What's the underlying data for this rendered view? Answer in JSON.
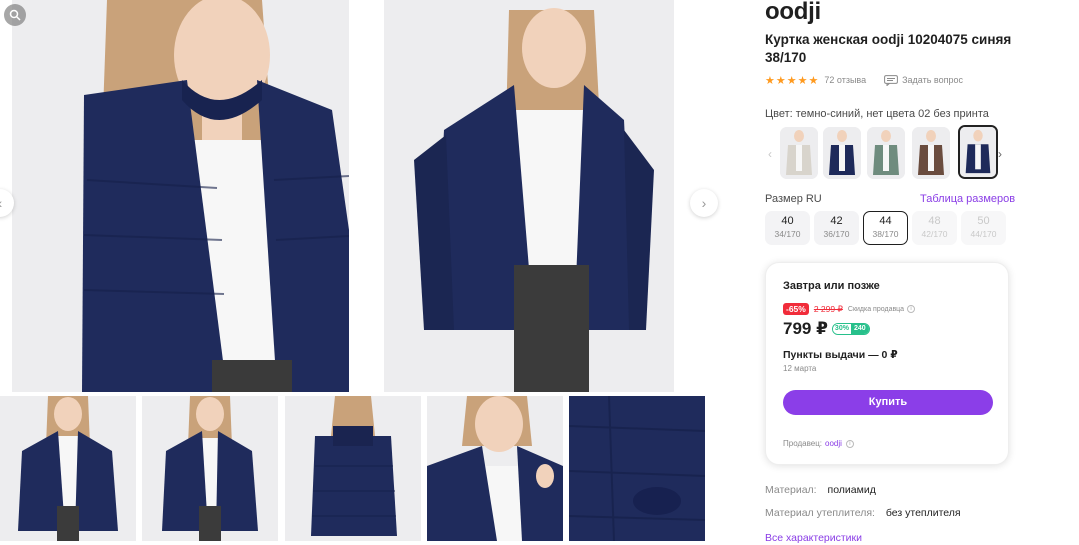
{
  "product": {
    "brand": "oodji",
    "title": "Куртка женская oodji 10204075 синяя 38/170",
    "rating": 5,
    "reviews": "72 отзыва",
    "ask_question": "Задать вопрос"
  },
  "gallery": {
    "icons": {
      "zoom": "search-icon",
      "prev": "chevron-left-icon",
      "next": "chevron-right-icon"
    }
  },
  "color": {
    "label": "Цвет: темно-синий, нет цвета 02 без принта",
    "swatches": [
      {
        "color": "#d8d4cc"
      },
      {
        "color": "#1e2a5a"
      },
      {
        "color": "#6f8c7e"
      },
      {
        "color": "#6a4c3e"
      },
      {
        "color": "#1e2a5a",
        "selected": true
      }
    ]
  },
  "size": {
    "label": "Размер RU",
    "table_link": "Таблица размеров",
    "options": [
      {
        "n": "40",
        "h": "34/170"
      },
      {
        "n": "42",
        "h": "36/170"
      },
      {
        "n": "44",
        "h": "38/170",
        "selected": true
      },
      {
        "n": "48",
        "h": "42/170",
        "disabled": true
      },
      {
        "n": "50",
        "h": "44/170",
        "disabled": true
      }
    ]
  },
  "buy": {
    "delivery": "Завтра или позже",
    "discount": "-65%",
    "old_price": "2 299 ₽",
    "discount_note": "Скидка продавца",
    "price": "799 ₽",
    "bonus_pct": "30%",
    "bonus_points": "240",
    "pickup": "Пункты выдачи — 0 ₽",
    "pickup_date": "12 марта",
    "button": "Купить",
    "seller_label": "Продавец:",
    "seller_name": "oodji"
  },
  "specs": [
    {
      "k": "Материал:",
      "v": "полиамид"
    },
    {
      "k": "Материал утеплителя:",
      "v": "без утеплителя"
    }
  ],
  "all_specs": "Все характеристики",
  "colors": {
    "accent": "#8b3ee8",
    "discount": "#f12c3a",
    "star": "#ff9a1f",
    "jacket": "#1e2a5a",
    "bonus": "#27c08b"
  }
}
